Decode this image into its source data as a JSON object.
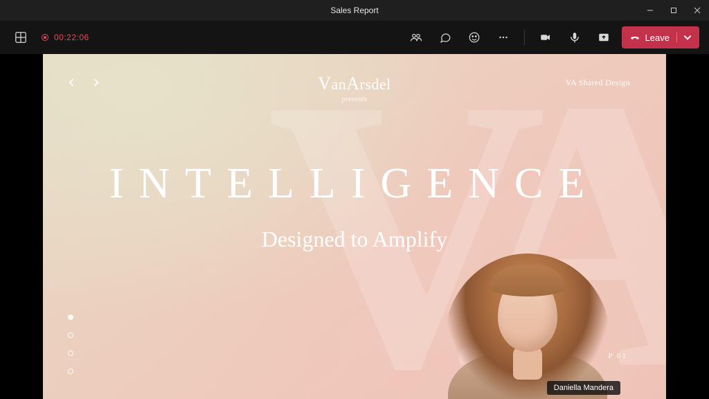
{
  "window": {
    "title": "Sales Report"
  },
  "toolbar": {
    "timer": "00:22:06",
    "leave_label": "Leave"
  },
  "slide": {
    "brand_name": "VanArsdel",
    "brand_sub": "presents",
    "corner_label": "VA Shared Design",
    "headline": "INTELLIGENCE",
    "subhead": "Designed to Amplify",
    "page_label": "P 01",
    "watermark": "VA",
    "dot_count": 4,
    "active_dot_index": 0
  },
  "presenter": {
    "name": "Daniella Mandera"
  }
}
